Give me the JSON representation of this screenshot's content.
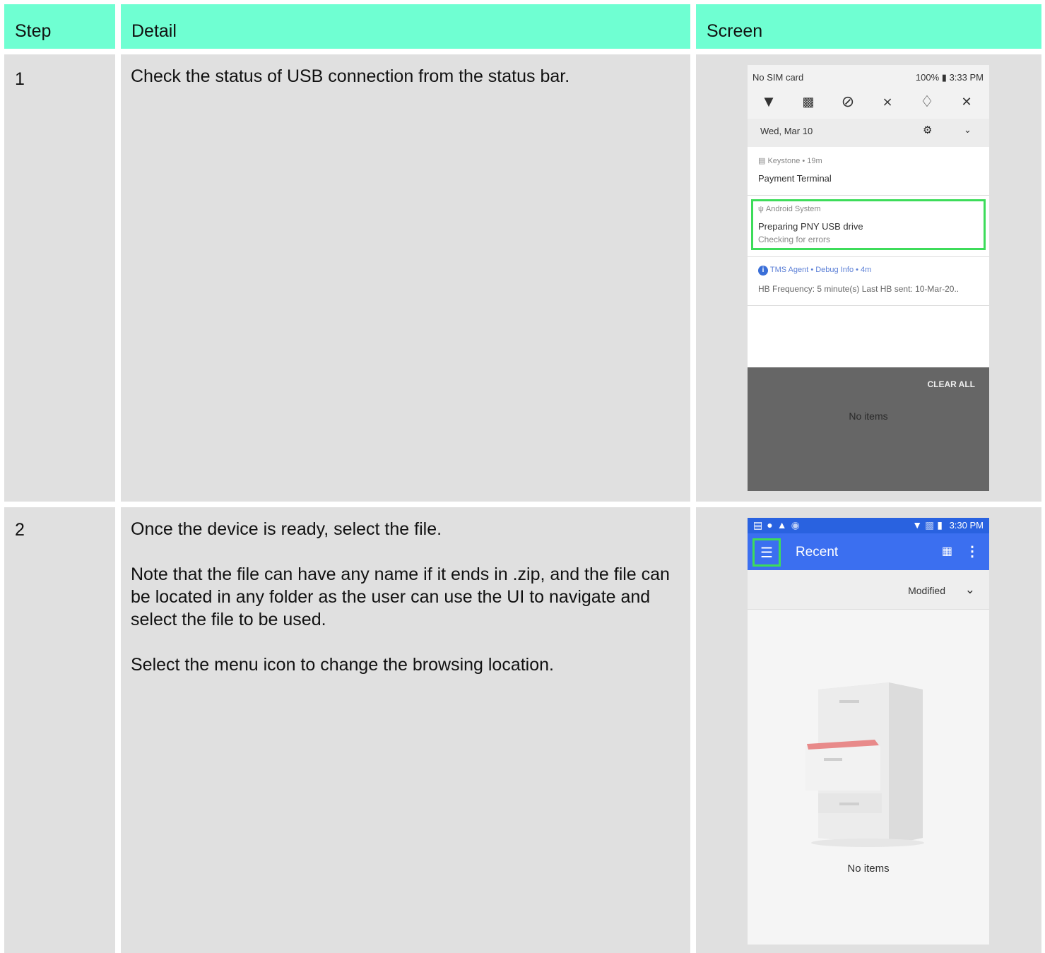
{
  "table": {
    "headers": {
      "step": "Step",
      "detail": "Detail",
      "screen": "Screen"
    },
    "rows": [
      {
        "step": "1",
        "detail": [
          "Check the status of USB connection from the status bar."
        ]
      },
      {
        "step": "2",
        "detail": [
          "Once the device is ready, select the file.",
          "Note that the file can have any name if it ends in .zip, and the file can be located in any folder as the user can use the UI to navigate and select the file to be used.",
          "Select the menu icon to change the browsing location."
        ]
      }
    ]
  },
  "screen1": {
    "sim": "No SIM card",
    "battery": "100%",
    "time": "3:33 PM",
    "date": "Wed, Mar 10",
    "notifications": [
      {
        "app": "Keystone • 19m",
        "title": "Payment Terminal"
      },
      {
        "app": "Android System",
        "title": "Preparing PNY USB drive",
        "sub": "Checking for errors"
      },
      {
        "app": "TMS Agent • Debug Info • 4m",
        "title": "HB Frequency: 5 minute(s) Last HB sent: 10-Mar-20.."
      }
    ],
    "clear_all": "CLEAR ALL",
    "no_items": "No items"
  },
  "screen2": {
    "time": "3:30 PM",
    "title": "Recent",
    "sort": "Modified",
    "no_items": "No items"
  },
  "colors": {
    "header": "#6fffd2",
    "cell": "#e0e0e0",
    "highlight": "#3ddc5a",
    "appbar": "#3b6ff0"
  }
}
